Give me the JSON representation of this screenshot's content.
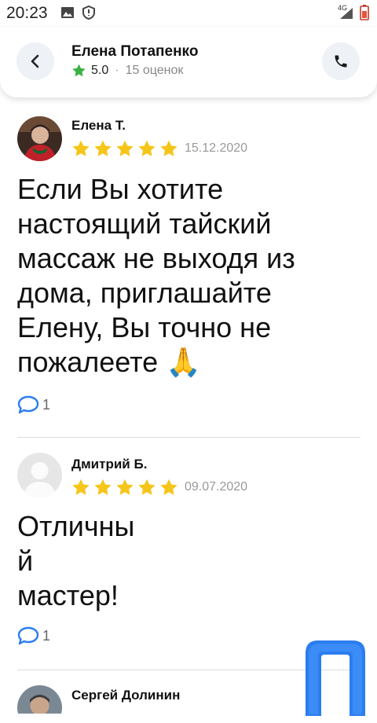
{
  "status_bar": {
    "time": "20:23",
    "network": "4G",
    "icons": [
      "image-icon",
      "shield-icon",
      "signal-icon",
      "battery-icon"
    ]
  },
  "header": {
    "name": "Елена Потапенко",
    "rating": "5.0",
    "separator": "·",
    "count": "15 оценок",
    "back_icon": "chevron-left-icon",
    "call_icon": "phone-icon"
  },
  "reviews": [
    {
      "author": "Елена Т.",
      "stars": 5,
      "date": "15.12.2020",
      "text": "Если Вы хотите настоящий тайский массаж не выходя из дома, приглашайте Елену, Вы точно не пожалеете",
      "emoji": "🙏",
      "comments": "1"
    },
    {
      "author": "Дмитрий Б.",
      "stars": 5,
      "date": "09.07.2020",
      "text_lines": [
        "Отличны",
        "й",
        "мастер!"
      ],
      "comments": "1"
    },
    {
      "author": "Сергей Долинин"
    }
  ],
  "colors": {
    "star": "#f5c518",
    "rating_star": "#3cb043",
    "logo": "#2b7df0"
  }
}
